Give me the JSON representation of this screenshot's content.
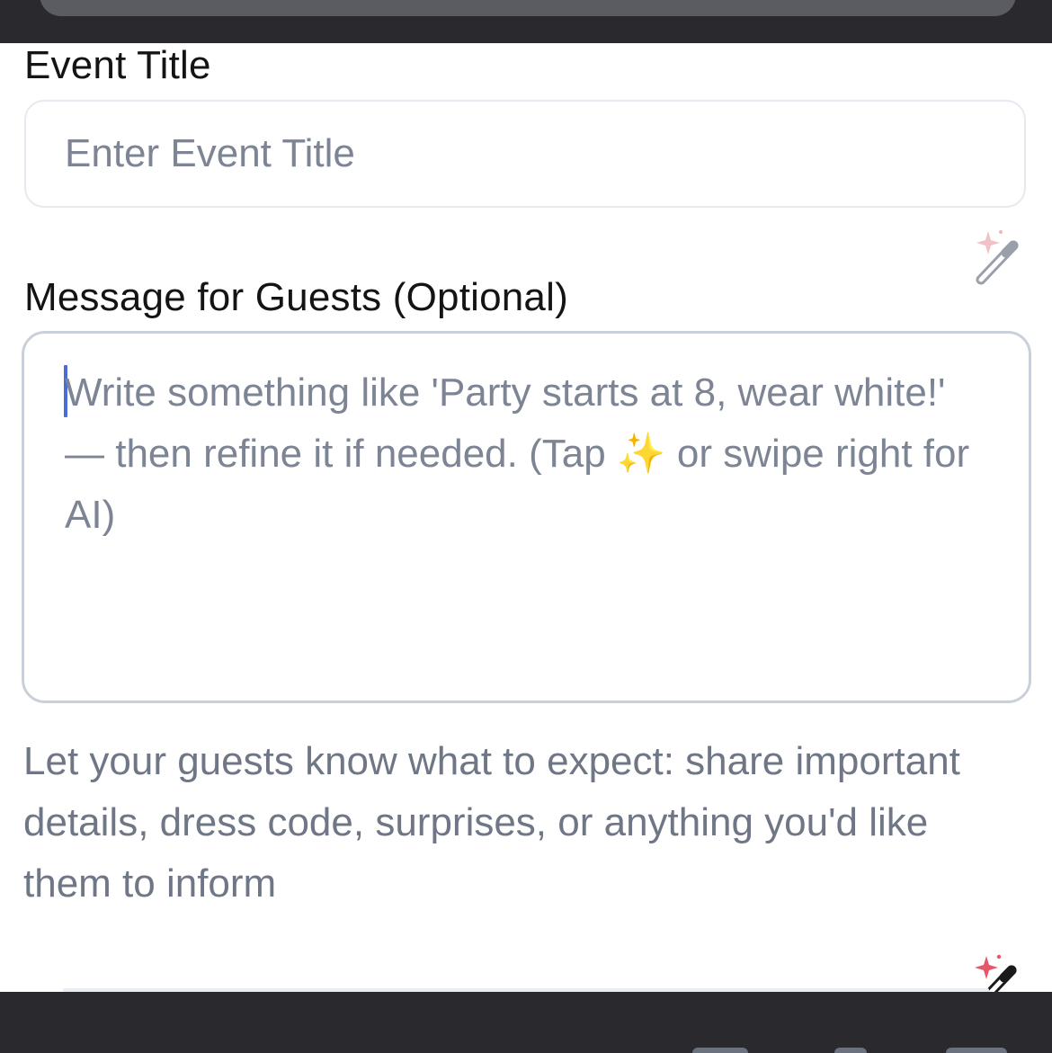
{
  "event_title": {
    "label": "Event Title",
    "placeholder": "Enter Event Title",
    "value": "",
    "ai_icon": "magic-wand-sparkle-icon"
  },
  "message": {
    "label": "Message for Guests (Optional)",
    "placeholder": "Write something like 'Party starts at 8, wear white!' — then refine it if needed. (Tap ✨ or swipe right for AI)",
    "value": "",
    "ai_icon": "magic-wand-sparkle-icon"
  },
  "helper_text": "Let your guests know what to expect: share important details, dress code, surprises, or anything you'd like them to inform",
  "colors": {
    "sparkle": "#e8556a",
    "wand": "#1a1a1a",
    "wand_muted": "#9aa0aa",
    "caret": "#4a6cd4",
    "placeholder": "#7d8594"
  }
}
